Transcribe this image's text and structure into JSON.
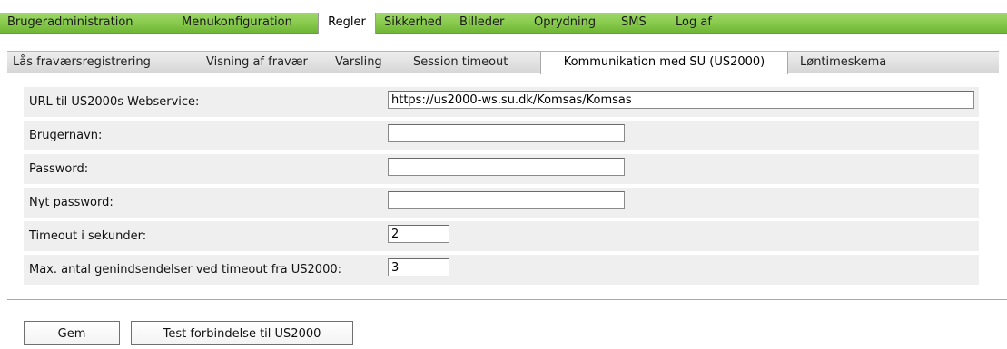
{
  "topnav": {
    "items": [
      {
        "label": "Brugeradministration"
      },
      {
        "label": "Menukonfiguration"
      },
      {
        "label": "Regler"
      },
      {
        "label": "Sikkerhed"
      },
      {
        "label": "Billeder"
      },
      {
        "label": "Oprydning"
      },
      {
        "label": "SMS"
      },
      {
        "label": "Log af"
      }
    ],
    "active_index": 2
  },
  "subnav": {
    "items": [
      {
        "label": "Lås fraværsregistrering"
      },
      {
        "label": "Visning af fravær"
      },
      {
        "label": "Varsling"
      },
      {
        "label": "Session timeout"
      },
      {
        "label": "Kommunikation med SU (US2000)"
      },
      {
        "label": "Løntimeskema"
      }
    ],
    "active_index": 4
  },
  "form": {
    "rows": [
      {
        "label": "URL til US2000s Webservice:",
        "value": "https://us2000-ws.su.dk/Komsas/Komsas"
      },
      {
        "label": "Brugernavn:",
        "value": ""
      },
      {
        "label": "Password:",
        "value": ""
      },
      {
        "label": "Nyt password:",
        "value": ""
      },
      {
        "label": "Timeout i sekunder:",
        "value": "2"
      },
      {
        "label": "Max. antal genindsendelser ved timeout fra US2000:",
        "value": "3"
      }
    ]
  },
  "buttons": {
    "save_label": "Gem",
    "test_label": "Test forbindelse til US2000"
  },
  "colors": {
    "menu_green": "#86c94b",
    "row_background": "#efefef"
  }
}
